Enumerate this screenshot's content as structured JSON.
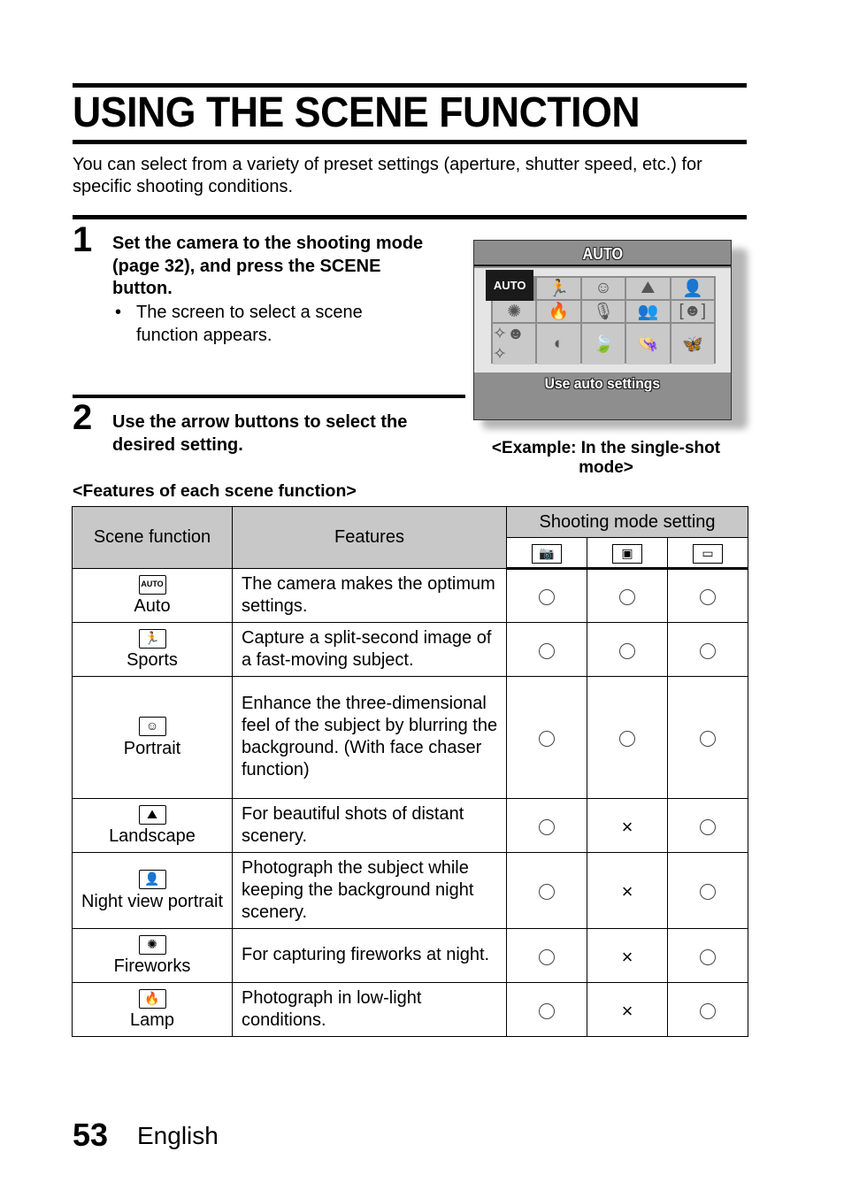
{
  "title": "USING THE SCENE FUNCTION",
  "intro": "You can select from a variety of preset settings (aperture, shutter speed, etc.) for specific shooting conditions.",
  "steps": [
    {
      "number": "1",
      "text": "Set the camera to the shooting mode (page 32), and press the SCENE button.",
      "bullet": "The screen to select a scene function appears."
    },
    {
      "number": "2",
      "text": "Use the arrow buttons to select the desired setting."
    }
  ],
  "camera_screen": {
    "header": "AUTO",
    "footer": "Use auto settings",
    "selected_index": 0,
    "icons": [
      {
        "name": "auto-icon",
        "glyph": "AUTO"
      },
      {
        "name": "sports-icon",
        "glyph": "🏃"
      },
      {
        "name": "portrait-icon",
        "glyph": "☺"
      },
      {
        "name": "landscape-icon",
        "glyph": "⛰"
      },
      {
        "name": "night-portrait-icon",
        "glyph": "👤"
      },
      {
        "name": "fireworks-icon",
        "glyph": "✺"
      },
      {
        "name": "lamp-icon",
        "glyph": "🔥"
      },
      {
        "name": "mic-icon",
        "glyph": "🎙"
      },
      {
        "name": "group-icon",
        "glyph": "👥"
      },
      {
        "name": "face-frame-icon",
        "glyph": "[☻]"
      },
      {
        "name": "sparkle-face-icon",
        "glyph": "✧☻✧"
      },
      {
        "name": "contrast-icon",
        "glyph": "◐"
      },
      {
        "name": "leaf-icon",
        "glyph": "🍃"
      },
      {
        "name": "hat-icon",
        "glyph": "👒"
      },
      {
        "name": "butterfly-icon",
        "glyph": "🦋"
      }
    ],
    "caption": "<Example: In the single-shot mode>"
  },
  "features_heading": "<Features of each scene function>",
  "table": {
    "headers": {
      "scene": "Scene function",
      "features": "Features",
      "shooting_mode": "Shooting mode setting"
    },
    "mode_icons": [
      {
        "name": "single-shot-icon",
        "glyph": "📷"
      },
      {
        "name": "sequential-shot-icon",
        "glyph": "▣"
      },
      {
        "name": "video-icon",
        "glyph": "▭"
      }
    ],
    "rows": [
      {
        "icon": "AUTO",
        "icon_name": "auto-scene-icon",
        "scene": "Auto",
        "features": "The camera makes the optimum settings.",
        "marks": [
          "○",
          "○",
          "○"
        ]
      },
      {
        "icon": "🏃",
        "icon_name": "sports-scene-icon",
        "scene": "Sports",
        "features": "Capture a split-second image of a fast-moving subject.",
        "marks": [
          "○",
          "○",
          "○"
        ]
      },
      {
        "icon": "☺",
        "icon_name": "portrait-scene-icon",
        "scene": "Portrait",
        "features": "Enhance the three-dimensional feel of the subject by blurring the background. (With face chaser function)",
        "marks": [
          "○",
          "○",
          "○"
        ]
      },
      {
        "icon": "⛰",
        "icon_name": "landscape-scene-icon",
        "scene": "Landscape",
        "features": "For beautiful shots of distant scenery.",
        "marks": [
          "○",
          "×",
          "○"
        ]
      },
      {
        "icon": "👤",
        "icon_name": "night-portrait-scene-icon",
        "scene": "Night view portrait",
        "features": "Photograph the subject while keeping the background night scenery.",
        "marks": [
          "○",
          "×",
          "○"
        ]
      },
      {
        "icon": "✺",
        "icon_name": "fireworks-scene-icon",
        "scene": "Fireworks",
        "features": "For capturing fireworks at night.",
        "marks": [
          "○",
          "×",
          "○"
        ]
      },
      {
        "icon": "🔥",
        "icon_name": "lamp-scene-icon",
        "scene": "Lamp",
        "features": "Photograph in low-light conditions.",
        "marks": [
          "○",
          "×",
          "○"
        ]
      }
    ]
  },
  "footer": {
    "page_number": "53",
    "language": "English"
  }
}
